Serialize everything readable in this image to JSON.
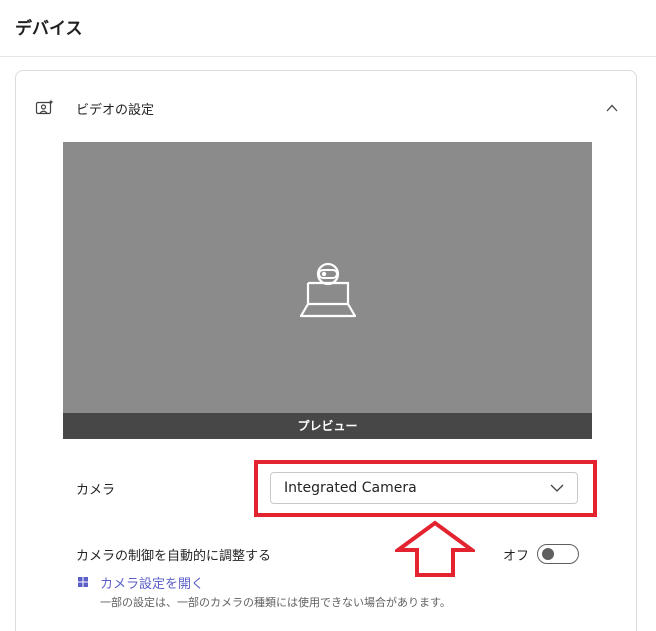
{
  "page": {
    "title": "デバイス"
  },
  "video_settings": {
    "title": "ビデオの設定",
    "icons": {
      "section": "video-settings-icon",
      "collapse": "chevron-up-icon",
      "preview": "camera-icon"
    },
    "preview_label": "プレビュー",
    "camera": {
      "label": "カメラ",
      "selected": "Integrated Camera"
    },
    "auto_adjust": {
      "label": "カメラの制御を自動的に調整する",
      "state_label": "オフ",
      "enabled": false
    },
    "open_settings_link": "カメラ設定を開く",
    "note": "一部の設定は、一部のカメラの種類には使用できない場合があります。"
  },
  "colors": {
    "highlight": "#e3232f",
    "link": "#5b5fc7",
    "preview_bg": "#8b8b8b",
    "preview_bar": "#474747"
  }
}
